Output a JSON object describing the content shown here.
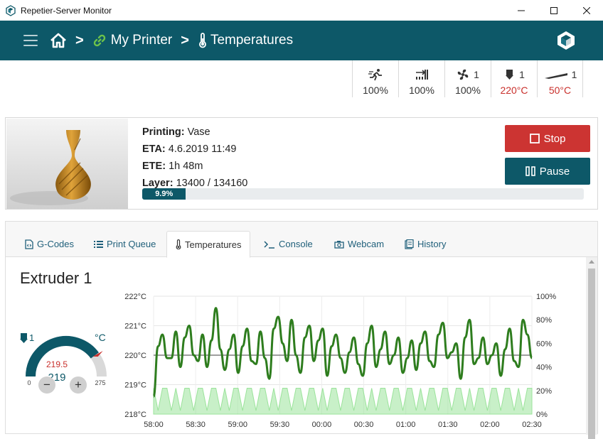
{
  "window": {
    "title": "Repetier-Server Monitor"
  },
  "nav": {
    "printer": "My Printer",
    "page": "Temperatures"
  },
  "status": [
    {
      "icon": "speed-icon",
      "count": "",
      "value": "100%",
      "hot": false
    },
    {
      "icon": "flow-icon",
      "count": "",
      "value": "100%",
      "hot": false
    },
    {
      "icon": "fan-icon",
      "count": "1",
      "value": "100%",
      "hot": false
    },
    {
      "icon": "extruder-icon",
      "count": "1",
      "value": "220°C",
      "hot": true
    },
    {
      "icon": "bed-icon",
      "count": "1",
      "value": "50°C",
      "hot": true
    }
  ],
  "job": {
    "printing_label": "Printing:",
    "printing": "Vase",
    "eta_label": "ETA:",
    "eta": "4.6.2019 11:49",
    "ete_label": "ETE:",
    "ete": "1h 48m",
    "layer_label": "Layer:",
    "layer": "13400 / 134160",
    "progress": 9.9,
    "progress_text": "9.9%",
    "stop_label": "Stop",
    "pause_label": "Pause"
  },
  "tabs": [
    "G-Codes",
    "Print Queue",
    "Temperatures",
    "Console",
    "Webcam",
    "History"
  ],
  "extruder": {
    "title": "Extruder 1",
    "count": "1",
    "unit": "°C",
    "current": "219.5",
    "target": "219",
    "min": "0",
    "max": "275"
  },
  "chart_data": {
    "type": "line",
    "x_ticks": [
      "58:00",
      "58:30",
      "59:00",
      "59:30",
      "00:00",
      "00:30",
      "01:00",
      "01:30",
      "02:00",
      "02:30"
    ],
    "y_left_ticks": [
      "222°C",
      "221°C",
      "220°C",
      "219°C",
      "218°C"
    ],
    "y_right_ticks": [
      "100%",
      "80%",
      "60%",
      "40%",
      "20%",
      "0%"
    ],
    "ylim_left": [
      218,
      222
    ],
    "ylim_right": [
      0,
      100
    ],
    "target_temperature": 220,
    "colors": {
      "temperature": "#2e7d1e",
      "output": "#9be39b",
      "target": "#666666"
    },
    "series": [
      {
        "name": "",
        "axis": "left",
        "values": [
          218.6,
          220.3,
          220.7,
          219.9,
          219.9,
          220.8,
          219.6,
          220.6,
          221.0,
          220.0,
          219.8,
          220.7,
          219.6,
          220.5,
          221.6,
          220.2,
          219.5,
          220.2,
          220.7,
          219.4,
          220.3,
          220.9,
          219.8,
          219.7,
          220.8,
          219.9,
          219.2,
          220.9,
          221.3,
          220.4,
          219.8,
          221.2,
          220.0,
          219.4,
          220.6,
          221.0,
          219.8,
          220.5,
          220.9,
          219.3,
          220.3,
          220.7,
          219.9,
          219.4,
          220.1,
          220.6,
          219.7,
          219.3,
          220.4,
          221.0,
          219.6,
          220.2,
          220.8,
          219.7,
          220.0,
          220.6,
          219.4,
          219.9,
          220.5,
          219.5,
          220.4,
          220.8,
          219.8,
          219.6,
          220.7,
          221.1,
          219.9,
          220.1,
          220.4,
          219.2,
          220.6,
          221.2,
          219.7,
          219.9,
          220.6,
          219.7,
          220.0,
          220.4,
          219.3,
          220.2,
          220.9,
          219.8,
          219.6,
          221.2,
          220.7,
          219.9
        ]
      },
      {
        "name": "",
        "axis": "right",
        "values": [
          22,
          3,
          22,
          22,
          3,
          22,
          3,
          22,
          22,
          3,
          22,
          22,
          3,
          22,
          22,
          3,
          22,
          3,
          22,
          22,
          3,
          22,
          22,
          3,
          22,
          22,
          3,
          22,
          3,
          22,
          22,
          3,
          22,
          22,
          3,
          22,
          22,
          3,
          22,
          3,
          22,
          22,
          3,
          22,
          22,
          3,
          22,
          22,
          3,
          22,
          3,
          22,
          22,
          3,
          22,
          22,
          3,
          22,
          22,
          3,
          22,
          3,
          22,
          22,
          3,
          22,
          22,
          3,
          22,
          22,
          3,
          22,
          3,
          22,
          22,
          3,
          22,
          22,
          3,
          22,
          22,
          3,
          22,
          3,
          22,
          22
        ]
      }
    ]
  }
}
